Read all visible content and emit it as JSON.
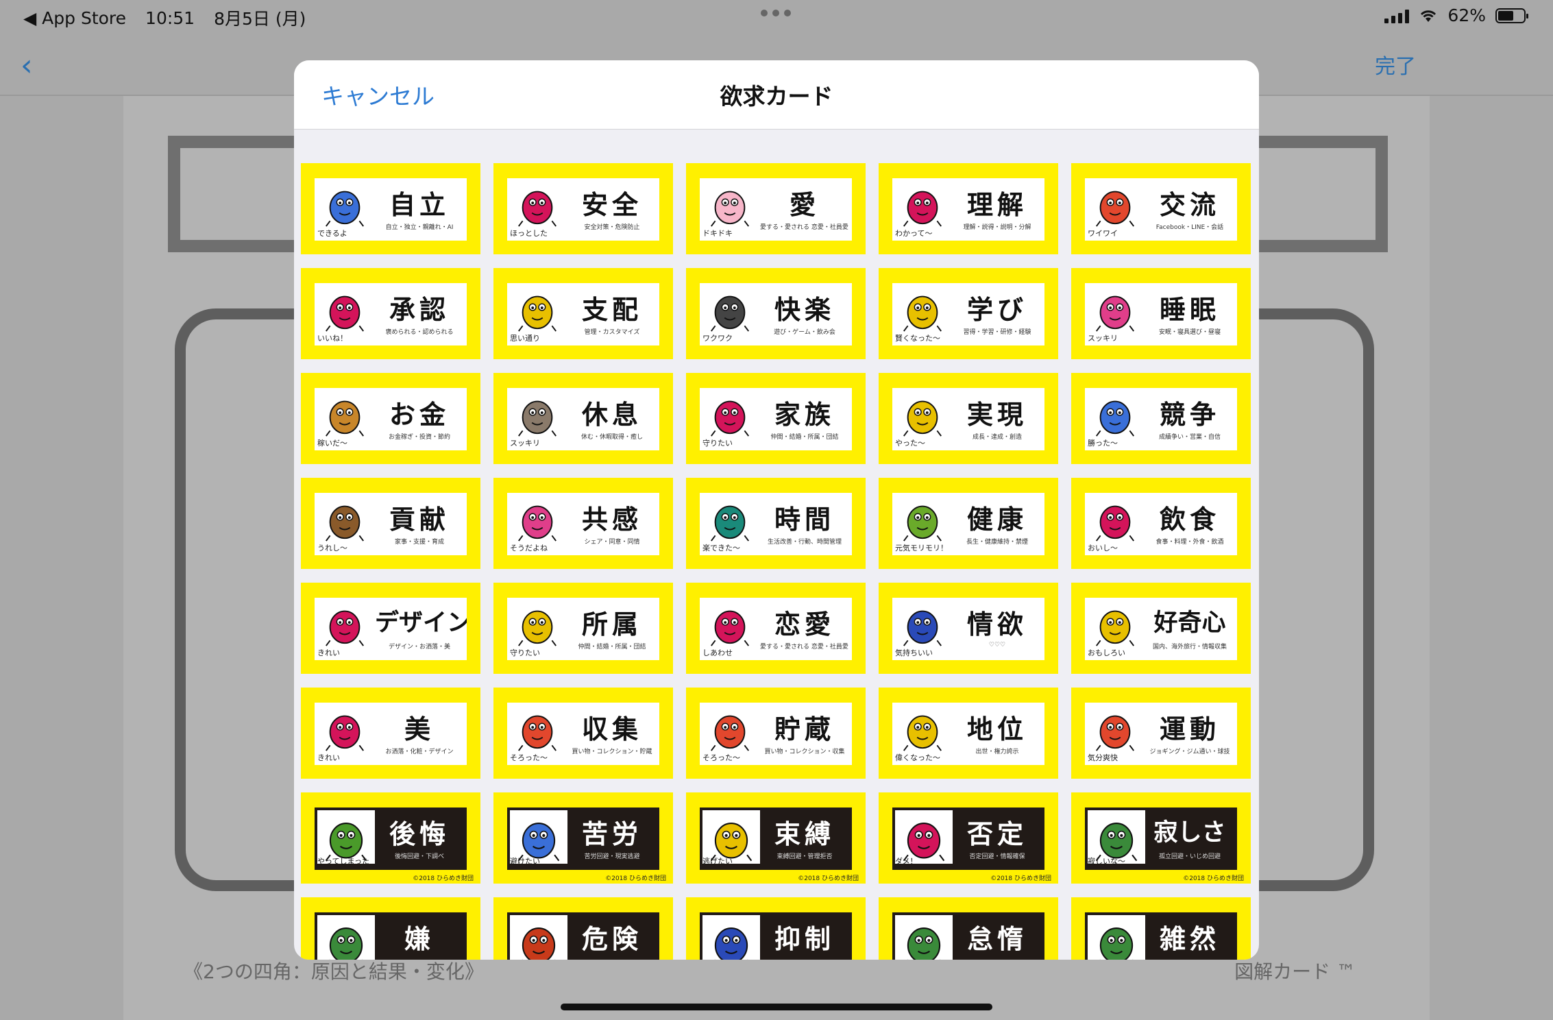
{
  "status": {
    "back_app": "◀ App Store",
    "time": "10:51",
    "date": "8月5日 (月)",
    "battery": "62%",
    "battery_level": 0.62
  },
  "background": {
    "back_icon": "chevron-left-icon",
    "done_label": "完了",
    "caption_left": "《2つの四角：原因と結果・変化》",
    "caption_right": "図解カード ™"
  },
  "modal": {
    "cancel_label": "キャンセル",
    "title": "欲求カード"
  },
  "card_colors": {
    "frame": "#fff000",
    "dark": "#211a17"
  },
  "cards": [
    {
      "word": "自立",
      "sub": "自立・独立・親離れ・AI",
      "cap": "できるよ",
      "dark": false,
      "icon": "figure-icon",
      "color": "#3a6fd8"
    },
    {
      "word": "安全",
      "sub": "安全対策・危険防止",
      "cap": "ほっとした",
      "dark": false,
      "icon": "seat-icon",
      "color": "#d4145a"
    },
    {
      "word": "愛",
      "sub": "愛する・愛される 恋愛・社員愛・家族愛",
      "cap": "ドキドキ",
      "dark": false,
      "icon": "cupid-icon",
      "color": "#f7b6c9"
    },
    {
      "word": "理解",
      "sub": "理解・説得・説明・分解",
      "cap": "わかって～",
      "dark": false,
      "icon": "figure-icon",
      "color": "#d4145a"
    },
    {
      "word": "交流",
      "sub": "Facebook・LINE・会話",
      "cap": "ワイワイ",
      "dark": false,
      "icon": "group-icon",
      "color": "#e2472d"
    },
    {
      "word": "承認",
      "sub": "褒められる・認められる",
      "cap": "いいね！",
      "dark": false,
      "icon": "figure-icon",
      "color": "#d4145a"
    },
    {
      "word": "支配",
      "sub": "管理・カスタマイズ",
      "cap": "思い通り",
      "dark": false,
      "icon": "group-icon",
      "color": "#e8c000"
    },
    {
      "word": "快楽",
      "sub": "遊び・ゲーム・飲み会",
      "cap": "ワクワク",
      "dark": false,
      "icon": "bottle-icon",
      "color": "#444444"
    },
    {
      "word": "学び",
      "sub": "習得・学習・研修・経験",
      "cap": "賢くなった～",
      "dark": false,
      "icon": "moon-icon",
      "color": "#e8c000"
    },
    {
      "word": "睡眠",
      "sub": "安眠・寝具選び・昼寝",
      "cap": "スッキリ",
      "dark": false,
      "icon": "heart-icon",
      "color": "#e03e8a"
    },
    {
      "word": "お金",
      "sub": "お金稼ぎ・投資・節約",
      "cap": "稼いだ～",
      "dark": false,
      "icon": "figure-icon",
      "color": "#c8862a"
    },
    {
      "word": "休息",
      "sub": "休む・休暇取得・癒し",
      "cap": "スッキリ",
      "dark": false,
      "icon": "bath-icon",
      "color": "#8a7a6a"
    },
    {
      "word": "家族",
      "sub": "仲間・結婚・所属・団結",
      "cap": "守りたい",
      "dark": false,
      "icon": "figure-icon",
      "color": "#d4145a"
    },
    {
      "word": "実現",
      "sub": "成長・達成・創造",
      "cap": "やった～",
      "dark": false,
      "icon": "box-icon",
      "color": "#e8c000"
    },
    {
      "word": "競争",
      "sub": "成績争い・営業・自信",
      "cap": "勝った～",
      "dark": false,
      "icon": "group-icon",
      "color": "#3a6fd8"
    },
    {
      "word": "貢献",
      "sub": "家事・支援・育成",
      "cap": "うれし～",
      "dark": false,
      "icon": "figure-icon",
      "color": "#8a5a2a"
    },
    {
      "word": "共感",
      "sub": "シェア・同意・同情",
      "cap": "そうだよね",
      "dark": false,
      "icon": "heart-icon",
      "color": "#e03e8a"
    },
    {
      "word": "時間",
      "sub": "生活改善・行動、時間管理",
      "cap": "楽できた～",
      "dark": false,
      "icon": "laptop-icon",
      "color": "#1a8a7a"
    },
    {
      "word": "健康",
      "sub": "長生・健康維持・禁煙",
      "cap": "元気モリモリ！",
      "dark": false,
      "icon": "figure-icon",
      "color": "#6aaa2a"
    },
    {
      "word": "飲食",
      "sub": "食事・料理・外食・飲酒",
      "cap": "おいし～",
      "dark": false,
      "icon": "figure-icon",
      "color": "#d4145a"
    },
    {
      "word": "デザイン",
      "sub": "デザイン・お洒落・美",
      "cap": "きれい",
      "dark": false,
      "icon": "flower-icon",
      "color": "#d4145a"
    },
    {
      "word": "所属",
      "sub": "仲間・結婚・所属・団結",
      "cap": "守りたい",
      "dark": false,
      "icon": "box-icon",
      "color": "#e8c000"
    },
    {
      "word": "恋愛",
      "sub": "愛する・愛される 恋愛・社員愛・家族愛",
      "cap": "しあわせ",
      "dark": false,
      "icon": "couple-icon",
      "color": "#d4145a"
    },
    {
      "word": "情欲",
      "sub": "♡♡♡",
      "cap": "気持ちいい",
      "dark": false,
      "icon": "urchin-icon",
      "color": "#2a4ab8"
    },
    {
      "word": "好奇心",
      "sub": "国内、海外旅行・情報収集",
      "cap": "おもしろい",
      "dark": false,
      "icon": "figure-icon",
      "color": "#e8c000"
    },
    {
      "word": "美",
      "sub": "お洒落・化粧・デザイン",
      "cap": "きれい",
      "dark": false,
      "icon": "flower-icon",
      "color": "#d4145a"
    },
    {
      "word": "収集",
      "sub": "買い物・コレクション・貯蔵",
      "cap": "そろった～",
      "dark": false,
      "icon": "figure-icon",
      "color": "#e2472d"
    },
    {
      "word": "貯蔵",
      "sub": "買い物・コレクション・収集",
      "cap": "そろった～",
      "dark": false,
      "icon": "figure-icon",
      "color": "#e2472d"
    },
    {
      "word": "地位",
      "sub": "出世・権力誇示",
      "cap": "偉くなった～",
      "dark": false,
      "icon": "figure-icon",
      "color": "#e8c000"
    },
    {
      "word": "運動",
      "sub": "ジョギング・ジム通い・球技",
      "cap": "気分爽快",
      "dark": false,
      "icon": "sun-icon",
      "color": "#e2472d"
    },
    {
      "word": "後悔",
      "sub": "後悔回避・下調べ",
      "cap": "やってしまった",
      "dark": true,
      "icon": "figure-icon",
      "color": "#4a9a2a",
      "copy": "©2018 ひらめき財団"
    },
    {
      "word": "苦労",
      "sub": "苦労回避・現実逃避",
      "cap": "避けたい",
      "dark": true,
      "icon": "figure-icon",
      "color": "#3a6fd8",
      "copy": "©2018 ひらめき財団"
    },
    {
      "word": "束縛",
      "sub": "束縛回避・管理拒否",
      "cap": "逃げたい",
      "dark": true,
      "icon": "figure-icon",
      "color": "#e8c000",
      "copy": "©2018 ひらめき財団"
    },
    {
      "word": "否定",
      "sub": "否定回避・情報確保",
      "cap": "ダメ！",
      "dark": true,
      "icon": "mask-icon",
      "color": "#d4145a",
      "copy": "©2018 ひらめき財団"
    },
    {
      "word": "寂しさ",
      "sub": "孤立回避・いじめ回避",
      "cap": "寂しいな～",
      "dark": true,
      "icon": "figure-icon",
      "color": "#3a8a3a",
      "copy": "©2018 ひらめき財団"
    },
    {
      "word": "嫌",
      "sub": "",
      "cap": "",
      "dark": true,
      "icon": "group-icon",
      "color": "#3a8a3a",
      "copy": ""
    },
    {
      "word": "危険",
      "sub": "",
      "cap": "",
      "dark": true,
      "icon": "fire-icon",
      "color": "#c83a1a",
      "copy": ""
    },
    {
      "word": "抑制",
      "sub": "",
      "cap": "",
      "dark": true,
      "icon": "figure-icon",
      "color": "#2a4ab8",
      "copy": ""
    },
    {
      "word": "怠惰",
      "sub": "",
      "cap": "",
      "dark": true,
      "icon": "figure-icon",
      "color": "#3a8a3a",
      "copy": ""
    },
    {
      "word": "雑然",
      "sub": "",
      "cap": "",
      "dark": true,
      "icon": "stack-icon",
      "color": "#3a8a3a",
      "copy": ""
    }
  ]
}
